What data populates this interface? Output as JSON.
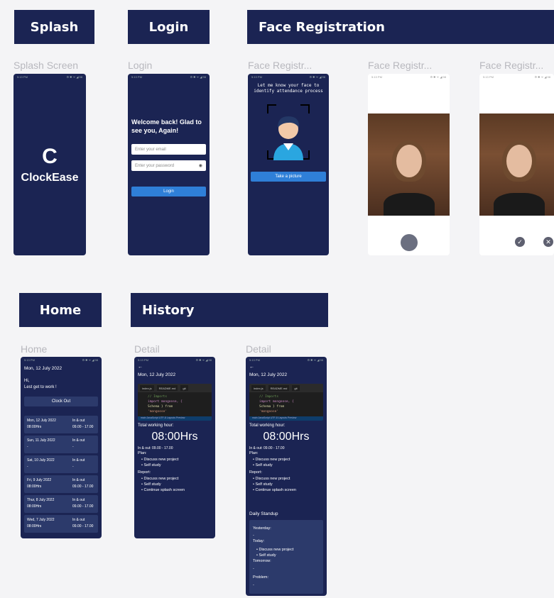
{
  "sections": {
    "splash": "Splash",
    "login": "Login",
    "face_registration": "Face Registration",
    "home": "Home",
    "history": "History"
  },
  "frame_labels": {
    "splash": "Splash Screen",
    "login": "Login",
    "face1": "Face Registr...",
    "face2": "Face Registr...",
    "face3": "Face Registr...",
    "home": "Home",
    "detail1": "Detail",
    "detail2": "Detail"
  },
  "status_bar": {
    "time": "5:13 PM",
    "icons": "⚙ ✱ ᯤ ◢ 98"
  },
  "splash": {
    "app_name": "ClockEase",
    "logo": "C"
  },
  "login": {
    "welcome": "Welcome back! Glad to see you, Again!",
    "email_placeholder": "Enter your email",
    "password_placeholder": "Enter your password",
    "button": "Login"
  },
  "face": {
    "instruction": "Let me know your face to identify attendance process",
    "button": "Take a picture"
  },
  "home": {
    "date": "Mon, 12 July 2022",
    "greeting1": "Hi,",
    "greeting2": "Lest get to work !",
    "clock_out": "Clock Out",
    "entries": [
      {
        "date": "Mon, 12 July 2022",
        "hours": "08:00Hrs",
        "label": "In & out",
        "range": "09.00 - 17.00"
      },
      {
        "date": "Sun, 11 July 2022",
        "hours": "-",
        "label": "In & out",
        "range": "-"
      },
      {
        "date": "Sat, 10 July 2022",
        "hours": "-",
        "label": "In & out",
        "range": "-"
      },
      {
        "date": "Fri, 9 July 2022",
        "hours": "08:00Hrs",
        "label": "In & out",
        "range": "09.00 - 17.00"
      },
      {
        "date": "Thur, 8 July 2022",
        "hours": "08:00Hrs",
        "label": "In & out",
        "range": "09.00 - 17.00"
      },
      {
        "date": "Wed, 7 July 2022",
        "hours": "08:00Hrs",
        "label": "In & out",
        "range": "09.00 - 17.00"
      }
    ]
  },
  "detail": {
    "back": "←",
    "date": "Mon, 12 July 2022",
    "tabs": [
      "index.js",
      "README.md",
      "git"
    ],
    "code": [
      "// Imports",
      "import mongoose, {",
      "Schema } from",
      "'mongoose'"
    ],
    "code_footer": "main  JavaScript  UTF-8  Layouts  Preview",
    "total_label": "Total working hour:",
    "hours": "08:00Hrs",
    "inout": "In & out: 09.00 - 17.00",
    "plan_label": "Plan:",
    "plan_items": [
      "Discuss new project",
      "Self study"
    ],
    "report_label": "Report:",
    "report_items": [
      "Discuss new project",
      "Self study",
      "Continue splash screen"
    ],
    "standup_label": "Daily Standup",
    "yesterday": "Yesterday:",
    "yesterday_val": "-",
    "today": "Today:",
    "today_items": [
      "Discuss new project",
      "Self study"
    ],
    "tomorrow": "Tomorrow:",
    "tomorrow_val": "-",
    "problem": "Problem:",
    "problem_val": "-"
  },
  "colors": {
    "navy": "#1b2453",
    "card": "#2c3a6b",
    "accent": "#2f7fd8",
    "bg": "#f4f4f6"
  }
}
